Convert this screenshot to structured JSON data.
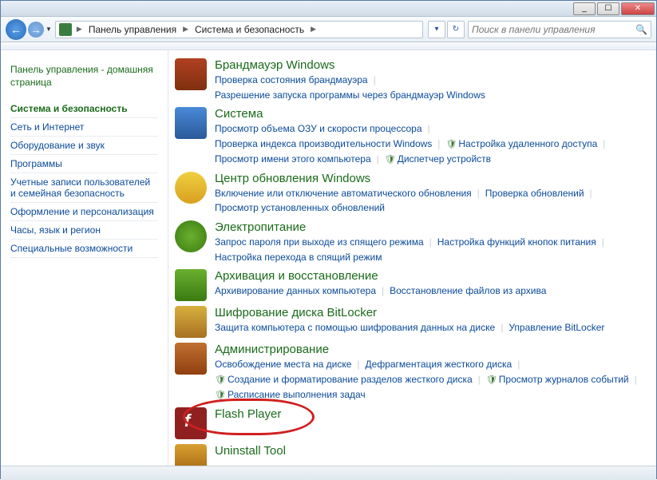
{
  "titlebar": {
    "min": "_",
    "max": "☐",
    "close": "✕"
  },
  "nav": {
    "breadcrumbs": [
      "Панель управления",
      "Система и безопасность"
    ],
    "search_placeholder": "Поиск в панели управления"
  },
  "sidebar": {
    "home": "Панель управления - домашняя страница",
    "items": [
      {
        "label": "Система и безопасность",
        "active": true
      },
      {
        "label": "Сеть и Интернет"
      },
      {
        "label": "Оборудование и звук"
      },
      {
        "label": "Программы"
      },
      {
        "label": "Учетные записи пользователей и семейная безопасность"
      },
      {
        "label": "Оформление и персонализация"
      },
      {
        "label": "Часы, язык и регион"
      },
      {
        "label": "Специальные возможности"
      }
    ]
  },
  "categories": [
    {
      "icon": "ic-firewall",
      "title": "Брандмауэр Windows",
      "links": [
        {
          "t": "Проверка состояния брандмауэра"
        },
        {
          "t": "Разрешение запуска программы через брандмауэр Windows"
        }
      ]
    },
    {
      "icon": "ic-system",
      "title": "Система",
      "links": [
        {
          "t": "Просмотр объема ОЗУ и скорости процессора"
        },
        {
          "t": "Проверка индекса производительности Windows"
        },
        {
          "t": "Настройка удаленного доступа",
          "shield": true
        },
        {
          "t": "Просмотр имени этого компьютера"
        },
        {
          "t": "Диспетчер устройств",
          "shield": true
        }
      ]
    },
    {
      "icon": "ic-update",
      "title": "Центр обновления Windows",
      "links": [
        {
          "t": "Включение или отключение автоматического обновления"
        },
        {
          "t": "Проверка обновлений"
        },
        {
          "t": "Просмотр установленных обновлений"
        }
      ]
    },
    {
      "icon": "ic-power",
      "title": "Электропитание",
      "links": [
        {
          "t": "Запрос пароля при выходе из спящего режима"
        },
        {
          "t": "Настройка функций кнопок питания"
        },
        {
          "t": "Настройка перехода в спящий режим"
        }
      ]
    },
    {
      "icon": "ic-backup",
      "title": "Архивация и восстановление",
      "links": [
        {
          "t": "Архивирование данных компьютера"
        },
        {
          "t": "Восстановление файлов из архива"
        }
      ]
    },
    {
      "icon": "ic-bitlocker",
      "title": "Шифрование диска BitLocker",
      "links": [
        {
          "t": "Защита компьютера с помощью шифрования данных на диске"
        },
        {
          "t": "Управление BitLocker"
        }
      ]
    },
    {
      "icon": "ic-admin",
      "title": "Администрирование",
      "links": [
        {
          "t": "Освобождение места на диске"
        },
        {
          "t": "Дефрагментация жесткого диска"
        },
        {
          "t": "Создание и форматирование разделов жесткого диска",
          "shield": true
        },
        {
          "t": "Просмотр журналов событий",
          "shield": true
        },
        {
          "t": "Расписание выполнения задач",
          "shield": true
        }
      ]
    },
    {
      "icon": "ic-flash",
      "title": "Flash Player",
      "links": []
    },
    {
      "icon": "ic-uninstall",
      "title": "Uninstall Tool",
      "links": []
    }
  ]
}
